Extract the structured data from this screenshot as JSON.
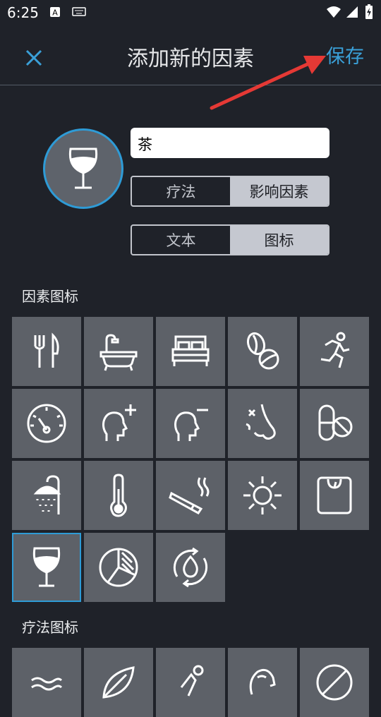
{
  "status_bar": {
    "time": "6:25"
  },
  "app_bar": {
    "title": "添加新的因素",
    "save_label": "保存"
  },
  "form": {
    "name_value": "茶",
    "type_options": [
      "疗法",
      "影响因素"
    ],
    "type_selected": "影响因素",
    "display_options": [
      "文本",
      "图标"
    ],
    "display_selected": "图标"
  },
  "sections": {
    "factor_icons_label": "因素图标",
    "therapy_icons_label": "疗法图标"
  },
  "factor_icons": [
    "fork-knife-icon",
    "bathtub-icon",
    "bed-icon",
    "coffee-beans-icon",
    "running-person-icon",
    "pressure-gauge-icon",
    "head-plus-icon",
    "head-minus-icon",
    "nose-icon",
    "pills-icon",
    "shower-icon",
    "thermometer-icon",
    "cigarette-icon",
    "sun-icon",
    "scale-icon",
    "wine-glass-icon",
    "pie-chart-icon",
    "water-cycle-icon"
  ],
  "selected_icon": "wine-glass-icon",
  "therapy_icons": [
    "waves-icon",
    "leaf-icon",
    "stretching-icon",
    "head-icon",
    "no-symbol-icon"
  ],
  "colors": {
    "accent": "#2e9bd6",
    "background": "#1f2229",
    "tile": "#5d6168"
  }
}
